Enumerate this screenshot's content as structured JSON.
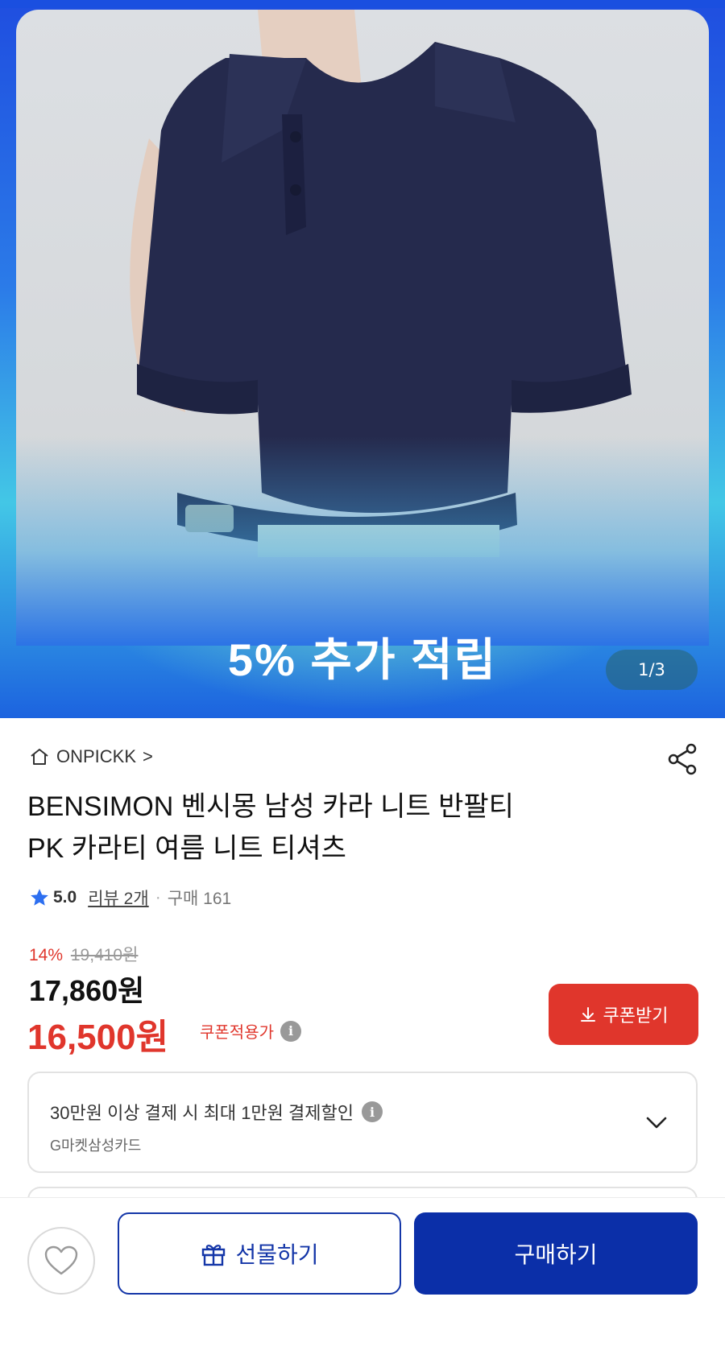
{
  "hero": {
    "promo_text": "5% 추가 적립",
    "page_indicator": "1/3"
  },
  "store": {
    "name": "ONPICKK",
    "arrow": ">"
  },
  "product": {
    "title_line1": "BENSIMON 벤시몽 남성 카라 니트 반팔티",
    "title_line2": "PK 카라티 여름 니트 티셔츠",
    "rating": "5.0",
    "reviews": "리뷰 2개",
    "separator": "·",
    "purchases": "구매 161"
  },
  "price": {
    "discount_rate": "14%",
    "original": "19,410원",
    "sale": "17,860원",
    "coupon_price": "16,500원",
    "coupon_label": "쿠폰적용가",
    "coupon_button": "쿠폰받기"
  },
  "card_offer": {
    "main": "30만원 이상 결제 시 최대 1만원 결제할인",
    "sub": "G마켓삼성카드"
  },
  "bottom_bar": {
    "gift_label": "선물하기",
    "buy_label": "구매하기"
  },
  "colors": {
    "accent_red": "#e0362c",
    "primary_blue": "#0b2fa8",
    "shirt_navy": "#22284a"
  }
}
